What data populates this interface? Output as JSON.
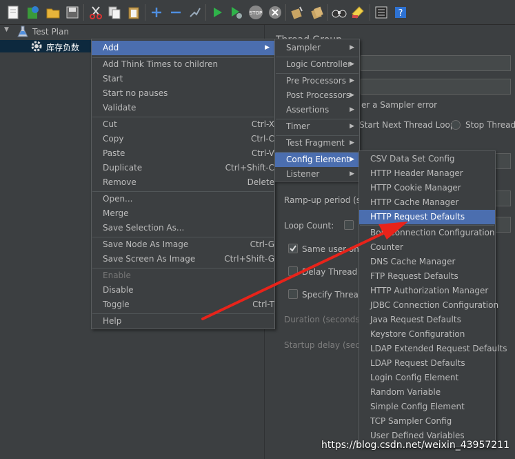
{
  "toolbar": {
    "icons": [
      "new-icon",
      "templates-icon",
      "open-icon",
      "save-icon",
      "cut-icon",
      "copy-icon",
      "paste-icon",
      "expand-icon",
      "collapse-icon",
      "toggle-icon",
      "start-icon",
      "start-no-pauses-icon",
      "stop-icon",
      "shutdown-icon",
      "clear-icon",
      "clear-all-icon",
      "search-icon",
      "reset-search-icon",
      "function-helper-icon",
      "help-icon"
    ]
  },
  "tree": {
    "root_label": "Test Plan",
    "child_label": "库存负数"
  },
  "right_panel": {
    "title": "Thread Group",
    "error_action_label": "er a Sampler error",
    "radio_start_next": "Start Next Thread Loop",
    "radio_stop_thread": "Stop Thread",
    "rampup_label": "Ramp-up period (sec",
    "loop_count_label": "Loop Count:",
    "same_user_label": "Same user on e",
    "delay_thread_label": "Delay Thread cr",
    "specify_thread_label": "Specify Thread",
    "duration_label": "Duration (seconds):",
    "startup_delay_label": "Startup delay (secon"
  },
  "context_menu": {
    "add": "Add",
    "add_think_times": "Add Think Times to children",
    "start": "Start",
    "start_no_pauses": "Start no pauses",
    "validate": "Validate",
    "cut": "Cut",
    "cut_sc": "Ctrl-X",
    "copy": "Copy",
    "copy_sc": "Ctrl-C",
    "paste": "Paste",
    "paste_sc": "Ctrl-V",
    "duplicate": "Duplicate",
    "duplicate_sc": "Ctrl+Shift-C",
    "remove": "Remove",
    "remove_sc": "Delete",
    "open": "Open...",
    "merge": "Merge",
    "save_selection": "Save Selection As...",
    "save_node_image": "Save Node As Image",
    "save_node_image_sc": "Ctrl-G",
    "save_screen_image": "Save Screen As Image",
    "save_screen_image_sc": "Ctrl+Shift-G",
    "enable": "Enable",
    "disable": "Disable",
    "toggle": "Toggle",
    "toggle_sc": "Ctrl-T",
    "help": "Help"
  },
  "add_menu": {
    "sampler": "Sampler",
    "logic_controller": "Logic Controller",
    "pre_processors": "Pre Processors",
    "post_processors": "Post Processors",
    "assertions": "Assertions",
    "timer": "Timer",
    "test_fragment": "Test Fragment",
    "config_element": "Config Element",
    "listener": "Listener"
  },
  "config_menu": {
    "items": [
      "CSV Data Set Config",
      "HTTP Header Manager",
      "HTTP Cookie Manager",
      "HTTP Cache Manager",
      "HTTP Request Defaults",
      "Bolt Connection Configuration",
      "Counter",
      "DNS Cache Manager",
      "FTP Request Defaults",
      "HTTP Authorization Manager",
      "JDBC Connection Configuration",
      "Java Request Defaults",
      "Keystore Configuration",
      "LDAP Extended Request Defaults",
      "LDAP Request Defaults",
      "Login Config Element",
      "Random Variable",
      "Simple Config Element",
      "TCP Sampler Config",
      "User Defined Variables"
    ],
    "selected": "HTTP Request Defaults"
  },
  "annotation": {
    "arrow_color": "#e8231a"
  },
  "watermark": "https://blog.csdn.net/weixin_43957211"
}
